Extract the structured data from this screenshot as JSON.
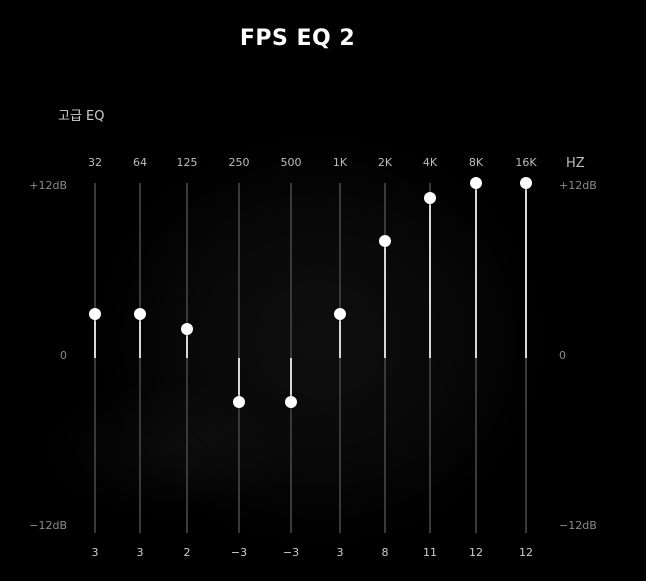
{
  "title": "FPS EQ 2",
  "section_label": "고급 EQ",
  "hz_label": "HZ",
  "scale": {
    "max": "+12dB",
    "zero": "0",
    "min": "−12dB"
  },
  "range_db": [
    -12,
    12
  ],
  "bands": [
    {
      "freq": "32",
      "value": 3,
      "value_label": "3"
    },
    {
      "freq": "64",
      "value": 3,
      "value_label": "3"
    },
    {
      "freq": "125",
      "value": 2,
      "value_label": "2"
    },
    {
      "freq": "250",
      "value": -3,
      "value_label": "−3"
    },
    {
      "freq": "500",
      "value": -3,
      "value_label": "−3"
    },
    {
      "freq": "1K",
      "value": 3,
      "value_label": "3"
    },
    {
      "freq": "2K",
      "value": 8,
      "value_label": "8"
    },
    {
      "freq": "4K",
      "value": 11,
      "value_label": "11"
    },
    {
      "freq": "8K",
      "value": 12,
      "value_label": "12"
    },
    {
      "freq": "16K",
      "value": 12,
      "value_label": "12"
    }
  ],
  "colors": {
    "background": "#000000",
    "track": "#3a3a3a",
    "fill": "#d8d8d8",
    "knob": "#ffffff"
  }
}
